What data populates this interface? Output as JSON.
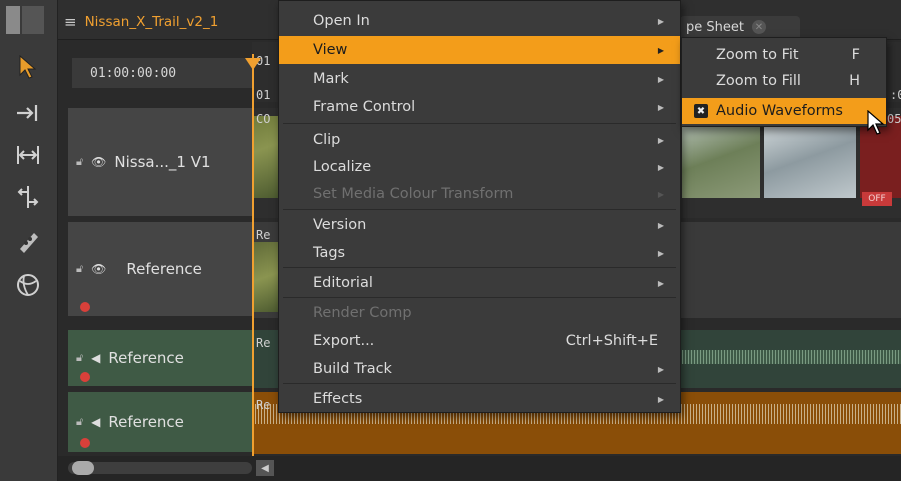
{
  "tab": {
    "title": "Nissan_X_Trail_v2_1",
    "sheet_tab": "pe Sheet"
  },
  "timeline": {
    "timecode": "01:00:00:00",
    "ruler_marks": [
      "01",
      "01",
      "CO",
      ":0",
      "05"
    ],
    "tracks": [
      {
        "label": "Nissa..._1 V1",
        "kind": "video"
      },
      {
        "label": "Reference",
        "kind": "video"
      },
      {
        "label": "Reference",
        "kind": "audio"
      },
      {
        "label": "Reference",
        "kind": "audio"
      }
    ],
    "clip_labels": [
      "Re",
      "Re",
      "Re"
    ],
    "off_badge": "OFF"
  },
  "menu": {
    "items": [
      {
        "label": "Open In",
        "submenu": true,
        "disabled": false
      },
      {
        "label": "View",
        "submenu": true,
        "disabled": false,
        "highlighted": true
      },
      {
        "label": "Mark",
        "submenu": true,
        "disabled": false
      },
      {
        "label": "Frame Control",
        "submenu": true,
        "disabled": false
      },
      {
        "label": "Clip",
        "submenu": true,
        "disabled": false
      },
      {
        "label": "Localize",
        "submenu": true,
        "disabled": false
      },
      {
        "label": "Set Media Colour Transform",
        "submenu": true,
        "disabled": true
      },
      {
        "label": "Version",
        "submenu": true,
        "disabled": false
      },
      {
        "label": "Tags",
        "submenu": true,
        "disabled": false
      },
      {
        "label": "Editorial",
        "submenu": true,
        "disabled": false
      },
      {
        "label": "Render Comp",
        "submenu": false,
        "disabled": true
      },
      {
        "label": "Export...",
        "submenu": false,
        "disabled": false,
        "shortcut": "Ctrl+Shift+E"
      },
      {
        "label": "Build Track",
        "submenu": true,
        "disabled": false
      },
      {
        "label": "Effects",
        "submenu": true,
        "disabled": false
      }
    ]
  },
  "submenu": {
    "items": [
      {
        "label": "Zoom to Fit",
        "shortcut": "F"
      },
      {
        "label": "Zoom to Fill",
        "shortcut": "H"
      },
      {
        "label": "Audio Waveforms",
        "checked": true,
        "highlighted": true
      }
    ]
  },
  "colors": {
    "accent": "#f39d1a",
    "title_orange": "#f0a030",
    "audio_track": "#3f5a45",
    "menu_bg": "#3b3b3b"
  }
}
